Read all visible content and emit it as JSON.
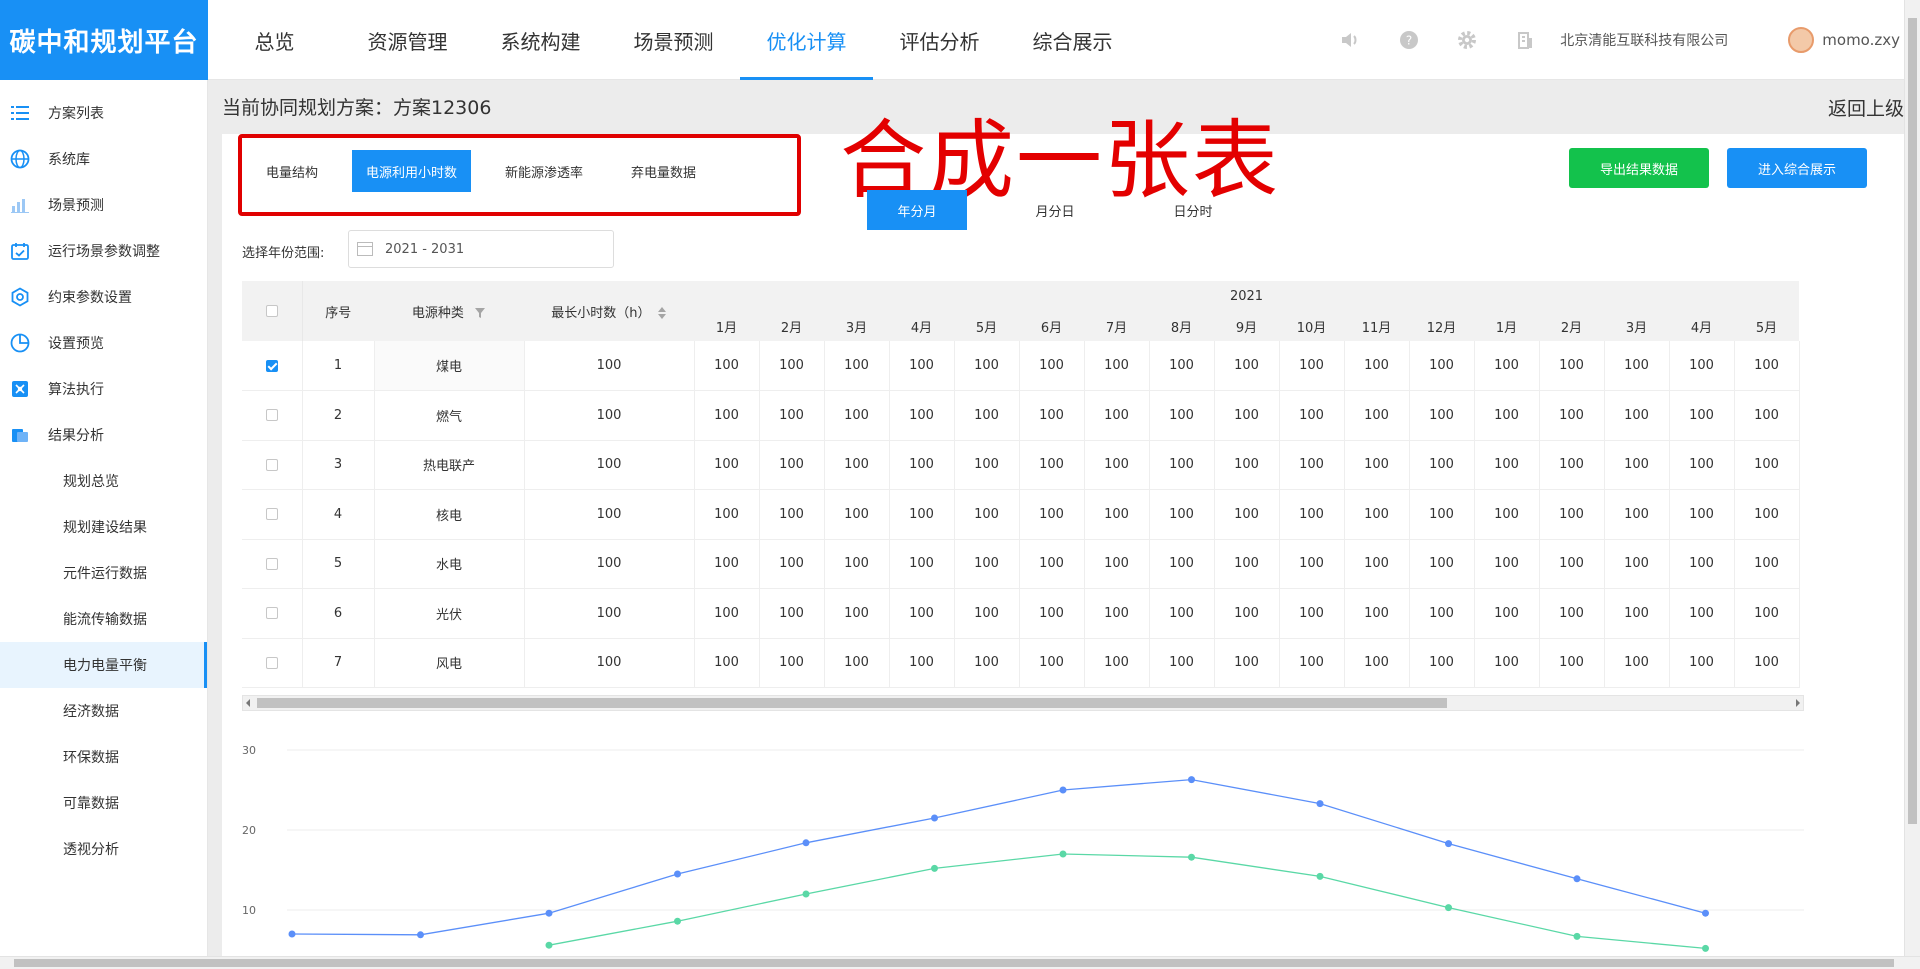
{
  "app": {
    "logo": "碳中和规划平台",
    "company": "北京清能互联科技有限公司",
    "user": "momo.zxy"
  },
  "nav": [
    {
      "label": "总览"
    },
    {
      "label": "资源管理"
    },
    {
      "label": "系统构建"
    },
    {
      "label": "场景预测"
    },
    {
      "label": "优化计算",
      "active": true
    },
    {
      "label": "评估分析"
    },
    {
      "label": "综合展示"
    }
  ],
  "sidebar": {
    "items": [
      {
        "label": "方案列表",
        "icon": "list-icon"
      },
      {
        "label": "系统库",
        "icon": "globe-icon"
      },
      {
        "label": "场景预测",
        "icon": "bar-chart-icon"
      },
      {
        "label": "运行场景参数调整",
        "icon": "calendar-check-icon"
      },
      {
        "label": "约束参数设置",
        "icon": "hexagon-settings-icon"
      },
      {
        "label": "设置预览",
        "icon": "pie-chart-icon"
      },
      {
        "label": "算法执行",
        "icon": "algorithm-icon"
      },
      {
        "label": "结果分析",
        "icon": "folder-icon"
      }
    ],
    "sub_items": [
      {
        "label": "规划总览"
      },
      {
        "label": "规划建设结果"
      },
      {
        "label": "元件运行数据"
      },
      {
        "label": "能流传输数据"
      },
      {
        "label": "电力电量平衡",
        "active": true
      },
      {
        "label": "经济数据"
      },
      {
        "label": "环保数据"
      },
      {
        "label": "可靠数据"
      },
      {
        "label": "透视分析"
      }
    ]
  },
  "plan": {
    "title": "当前协同规划方案：方案12306",
    "back": "返回上级"
  },
  "tabs": [
    {
      "label": "电量结构"
    },
    {
      "label": "电源利用小时数",
      "active": true
    },
    {
      "label": "新能源渗透率"
    },
    {
      "label": "弃电量数据"
    }
  ],
  "annotation": "合成一张表",
  "buttons": {
    "export": "导出结果数据",
    "enter": "进入综合展示"
  },
  "period": [
    {
      "label": "年分月",
      "active": true
    },
    {
      "label": "月分日"
    },
    {
      "label": "日分时"
    }
  ],
  "range": {
    "label": "选择年份范围:",
    "value": "2021 - 2031"
  },
  "table": {
    "year": "2021",
    "headers": {
      "index": "序号",
      "type": "电源种类",
      "max_hours": "最长小时数（h）"
    },
    "months": [
      "1月",
      "2月",
      "3月",
      "4月",
      "5月",
      "6月",
      "7月",
      "8月",
      "9月",
      "10月",
      "11月",
      "12月",
      "1月",
      "2月",
      "3月",
      "4月",
      "5月"
    ],
    "rows": [
      {
        "index": "1",
        "type": "煤电",
        "max": "100",
        "checked": true,
        "values": [
          "100",
          "100",
          "100",
          "100",
          "100",
          "100",
          "100",
          "100",
          "100",
          "100",
          "100",
          "100",
          "100",
          "100",
          "100",
          "100",
          "100"
        ]
      },
      {
        "index": "2",
        "type": "燃气",
        "max": "100",
        "checked": false,
        "values": [
          "100",
          "100",
          "100",
          "100",
          "100",
          "100",
          "100",
          "100",
          "100",
          "100",
          "100",
          "100",
          "100",
          "100",
          "100",
          "100",
          "100"
        ]
      },
      {
        "index": "3",
        "type": "热电联产",
        "max": "100",
        "checked": false,
        "values": [
          "100",
          "100",
          "100",
          "100",
          "100",
          "100",
          "100",
          "100",
          "100",
          "100",
          "100",
          "100",
          "100",
          "100",
          "100",
          "100",
          "100"
        ]
      },
      {
        "index": "4",
        "type": "核电",
        "max": "100",
        "checked": false,
        "values": [
          "100",
          "100",
          "100",
          "100",
          "100",
          "100",
          "100",
          "100",
          "100",
          "100",
          "100",
          "100",
          "100",
          "100",
          "100",
          "100",
          "100"
        ]
      },
      {
        "index": "5",
        "type": "水电",
        "max": "100",
        "checked": false,
        "values": [
          "100",
          "100",
          "100",
          "100",
          "100",
          "100",
          "100",
          "100",
          "100",
          "100",
          "100",
          "100",
          "100",
          "100",
          "100",
          "100",
          "100"
        ]
      },
      {
        "index": "6",
        "type": "光伏",
        "max": "100",
        "checked": false,
        "values": [
          "100",
          "100",
          "100",
          "100",
          "100",
          "100",
          "100",
          "100",
          "100",
          "100",
          "100",
          "100",
          "100",
          "100",
          "100",
          "100",
          "100"
        ]
      },
      {
        "index": "7",
        "type": "风电",
        "max": "100",
        "checked": false,
        "values": [
          "100",
          "100",
          "100",
          "100",
          "100",
          "100",
          "100",
          "100",
          "100",
          "100",
          "100",
          "100",
          "100",
          "100",
          "100",
          "100",
          "100"
        ]
      }
    ]
  },
  "chart_data": {
    "type": "line",
    "yticks": [
      "30",
      "20",
      "10"
    ],
    "ylim": [
      0,
      30
    ],
    "x": [
      1,
      2,
      3,
      4,
      5,
      6,
      7,
      8,
      9,
      10,
      11,
      12
    ],
    "series": [
      {
        "color": "#5b8ff9",
        "values": [
          7,
          6.9,
          9.6,
          14.5,
          18.4,
          21.5,
          25,
          26.3,
          23.3,
          18.3,
          13.9,
          9.6
        ]
      },
      {
        "color": "#5ad8a6",
        "values": [
          null,
          null,
          5.6,
          8.6,
          12,
          15.2,
          17,
          16.6,
          14.2,
          10.3,
          6.7,
          5.2
        ]
      }
    ],
    "grid": "horizontal",
    "colors": {
      "primary": "#1890f5",
      "green": "#13c24c",
      "annotation": "#e30000"
    }
  }
}
